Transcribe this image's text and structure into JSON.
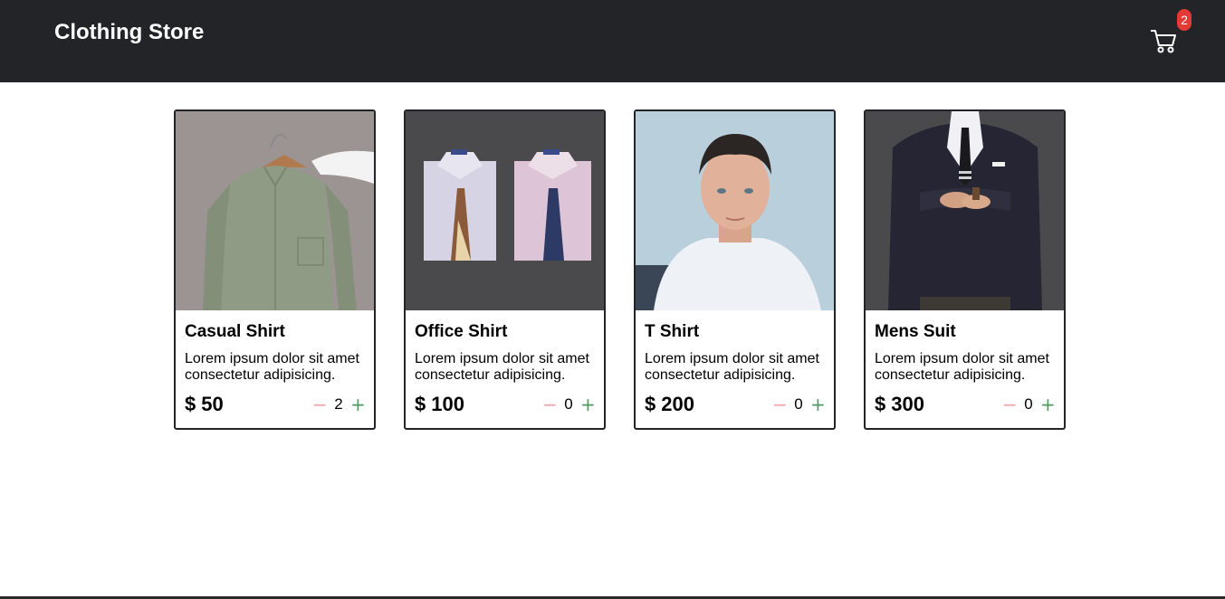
{
  "app": {
    "title": "Clothing Store"
  },
  "cart": {
    "count": "2",
    "icon": "cart-icon"
  },
  "colors": {
    "navbar": "#222428",
    "badge": "#e53935",
    "minus": "#f2a0a6",
    "plus": "#4f9a63"
  },
  "products": [
    {
      "name": "Casual Shirt",
      "description": "Lorem ipsum dolor sit amet consectetur adipisicing.",
      "currency": "$",
      "price": "50",
      "quantity": "2"
    },
    {
      "name": "Office Shirt",
      "description": "Lorem ipsum dolor sit amet consectetur adipisicing.",
      "currency": "$",
      "price": "100",
      "quantity": "0"
    },
    {
      "name": "T Shirt",
      "description": "Lorem ipsum dolor sit amet consectetur adipisicing.",
      "currency": "$",
      "price": "200",
      "quantity": "0"
    },
    {
      "name": "Mens Suit",
      "description": "Lorem ipsum dolor sit amet consectetur adipisicing.",
      "currency": "$",
      "price": "300",
      "quantity": "0"
    }
  ],
  "controls": {
    "minus": "−",
    "plus": "+"
  }
}
